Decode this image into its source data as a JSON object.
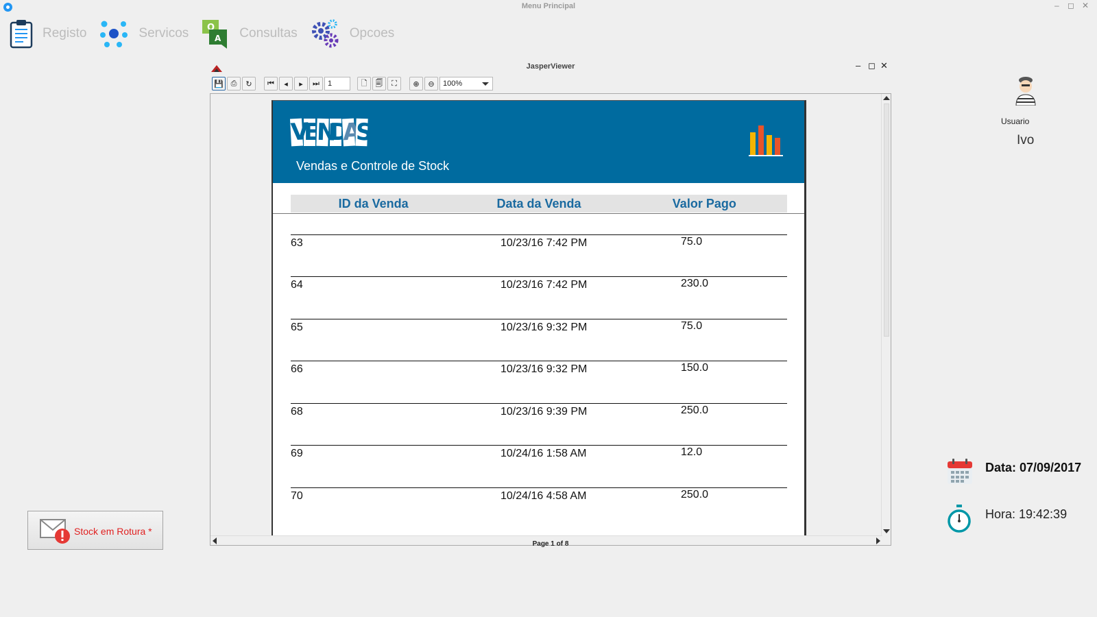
{
  "window": {
    "title": "Menu Principal",
    "controls": [
      "–",
      "◻",
      "✕"
    ]
  },
  "menu": [
    {
      "label": "Registo",
      "icon": "clipboard-icon"
    },
    {
      "label": "Servicos",
      "icon": "network-dots-icon"
    },
    {
      "label": "Consultas",
      "icon": "qa-chat-icon"
    },
    {
      "label": "Opcoes",
      "icon": "gears-icon"
    }
  ],
  "viewer": {
    "title": "JasperViewer",
    "page_number": "1",
    "zoom": "100%",
    "status": "Page 1 of 8"
  },
  "report": {
    "logo": [
      "V",
      "E",
      "N",
      "D",
      "A",
      "S"
    ],
    "subtitle": "Vendas e Controle de Stock",
    "columns": [
      "ID da Venda",
      "Data da Venda",
      "Valor Pago"
    ],
    "rows": [
      {
        "id": "63",
        "date": "10/23/16 7:42 PM",
        "value": "75.0"
      },
      {
        "id": "64",
        "date": "10/23/16 7:42 PM",
        "value": "230.0"
      },
      {
        "id": "65",
        "date": "10/23/16 9:32 PM",
        "value": "75.0"
      },
      {
        "id": "66",
        "date": "10/23/16 9:32 PM",
        "value": "150.0"
      },
      {
        "id": "68",
        "date": "10/23/16 9:39 PM",
        "value": "250.0"
      },
      {
        "id": "69",
        "date": "10/24/16 1:58 AM",
        "value": "12.0"
      },
      {
        "id": "70",
        "date": "10/24/16 4:58 AM",
        "value": "250.0"
      }
    ],
    "banner_color": "#006b9f"
  },
  "user": {
    "label": "Usuario",
    "name": "Ivo"
  },
  "datetime": {
    "date": "Data: 07/09/2017",
    "time": "Hora: 19:42:39"
  },
  "stock_button": {
    "label": "Stock em Rotura *"
  }
}
